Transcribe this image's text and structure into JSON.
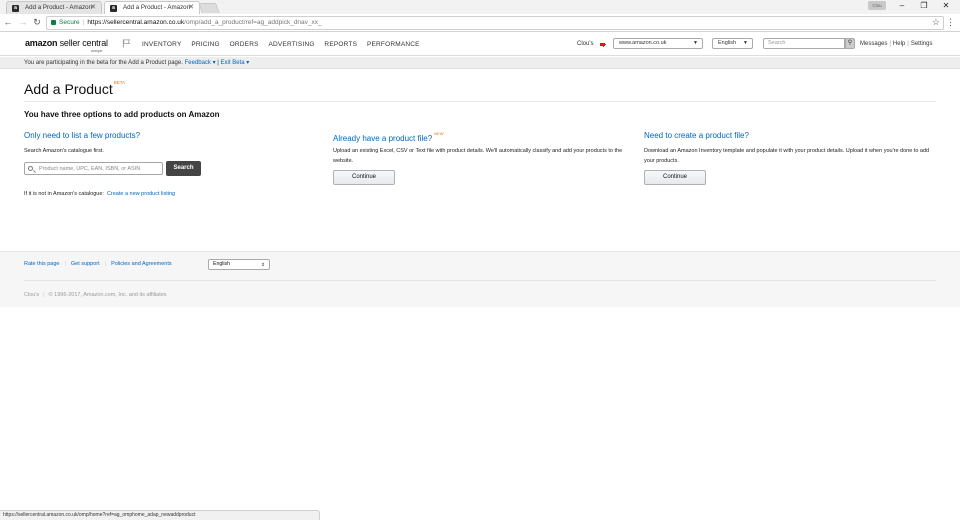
{
  "browser": {
    "tabs": [
      {
        "label": "Add a Product - Amazon"
      },
      {
        "label": "Add a Product - Amazon"
      }
    ],
    "profile_label": "Clou",
    "address": {
      "secure_label": "Secure",
      "host": "https://sellercentral.amazon.co.uk",
      "path": "/omp/add_a_product/ref=ag_addpick_dnav_xx_"
    },
    "status_url": "https://sellercentral.amazon.co.uk/omp/home?ref=ag_omphome_adap_newaddproduct"
  },
  "header": {
    "logo_amazon": "amazon",
    "logo_sc": " seller central",
    "logo_sub": "europe",
    "nav": [
      "INVENTORY",
      "PRICING",
      "ORDERS",
      "ADVERTISING",
      "REPORTS",
      "PERFORMANCE"
    ],
    "user": "Clou's",
    "marketplace": "www.amazon.co.uk",
    "language": "English",
    "search_placeholder": "Search",
    "links": [
      "Messages",
      "Help",
      "Settings"
    ]
  },
  "beta_bar": {
    "text": "You are participating in the beta for the Add a Product page.",
    "feedback": "Feedback",
    "exit": "Exit Beta"
  },
  "main": {
    "title": "Add a Product",
    "title_badge": "BETA",
    "subtitle": "You have three options to add products on Amazon",
    "col1": {
      "heading": "Only need to list a few products?",
      "text": "Search Amazon's catalogue first.",
      "search_placeholder": "Product name, UPC, EAN, ISBN, or ASIN",
      "search_button": "Search",
      "not_in_text": "If it is not in Amazon's catalogue:",
      "create_link": "Create a new product listing"
    },
    "col2": {
      "heading": "Already have a product file?",
      "badge": "NEW",
      "text": "Upload an existing Excel, CSV or Text file with product details. We'll automatically classify and add your products to the website.",
      "button": "Continue"
    },
    "col3": {
      "heading": "Need to create a product file?",
      "text": "Download an Amazon Inventory template and populate it with your product details. Upload it when you're done to add your products.",
      "button": "Continue"
    }
  },
  "footer": {
    "links": [
      "Rate this page",
      "Get support",
      "Policies and Agreements"
    ],
    "language": "English",
    "user": "Clou's",
    "copyright": "© 1996-2017, Amazon.com, Inc. and its affiliates"
  }
}
